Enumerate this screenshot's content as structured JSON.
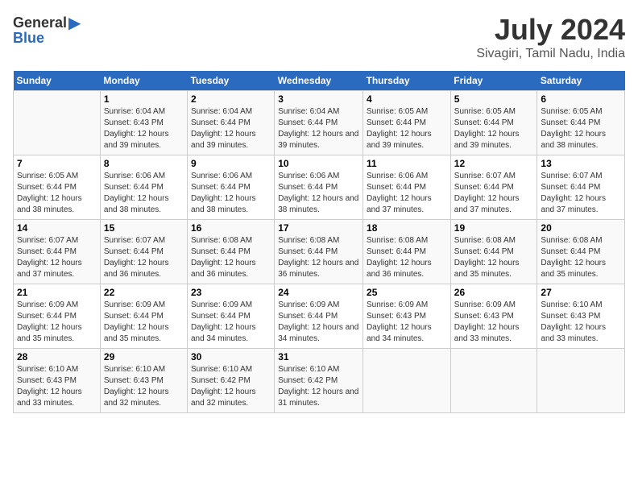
{
  "header": {
    "logo_general": "General",
    "logo_blue": "Blue",
    "title": "July 2024",
    "location": "Sivagiri, Tamil Nadu, India"
  },
  "calendar": {
    "days_of_week": [
      "Sunday",
      "Monday",
      "Tuesday",
      "Wednesday",
      "Thursday",
      "Friday",
      "Saturday"
    ],
    "weeks": [
      [
        {
          "day": "",
          "sunrise": "",
          "sunset": "",
          "daylight": ""
        },
        {
          "day": "1",
          "sunrise": "Sunrise: 6:04 AM",
          "sunset": "Sunset: 6:43 PM",
          "daylight": "Daylight: 12 hours and 39 minutes."
        },
        {
          "day": "2",
          "sunrise": "Sunrise: 6:04 AM",
          "sunset": "Sunset: 6:44 PM",
          "daylight": "Daylight: 12 hours and 39 minutes."
        },
        {
          "day": "3",
          "sunrise": "Sunrise: 6:04 AM",
          "sunset": "Sunset: 6:44 PM",
          "daylight": "Daylight: 12 hours and 39 minutes."
        },
        {
          "day": "4",
          "sunrise": "Sunrise: 6:05 AM",
          "sunset": "Sunset: 6:44 PM",
          "daylight": "Daylight: 12 hours and 39 minutes."
        },
        {
          "day": "5",
          "sunrise": "Sunrise: 6:05 AM",
          "sunset": "Sunset: 6:44 PM",
          "daylight": "Daylight: 12 hours and 39 minutes."
        },
        {
          "day": "6",
          "sunrise": "Sunrise: 6:05 AM",
          "sunset": "Sunset: 6:44 PM",
          "daylight": "Daylight: 12 hours and 38 minutes."
        }
      ],
      [
        {
          "day": "7",
          "sunrise": "Sunrise: 6:05 AM",
          "sunset": "Sunset: 6:44 PM",
          "daylight": "Daylight: 12 hours and 38 minutes."
        },
        {
          "day": "8",
          "sunrise": "Sunrise: 6:06 AM",
          "sunset": "Sunset: 6:44 PM",
          "daylight": "Daylight: 12 hours and 38 minutes."
        },
        {
          "day": "9",
          "sunrise": "Sunrise: 6:06 AM",
          "sunset": "Sunset: 6:44 PM",
          "daylight": "Daylight: 12 hours and 38 minutes."
        },
        {
          "day": "10",
          "sunrise": "Sunrise: 6:06 AM",
          "sunset": "Sunset: 6:44 PM",
          "daylight": "Daylight: 12 hours and 38 minutes."
        },
        {
          "day": "11",
          "sunrise": "Sunrise: 6:06 AM",
          "sunset": "Sunset: 6:44 PM",
          "daylight": "Daylight: 12 hours and 37 minutes."
        },
        {
          "day": "12",
          "sunrise": "Sunrise: 6:07 AM",
          "sunset": "Sunset: 6:44 PM",
          "daylight": "Daylight: 12 hours and 37 minutes."
        },
        {
          "day": "13",
          "sunrise": "Sunrise: 6:07 AM",
          "sunset": "Sunset: 6:44 PM",
          "daylight": "Daylight: 12 hours and 37 minutes."
        }
      ],
      [
        {
          "day": "14",
          "sunrise": "Sunrise: 6:07 AM",
          "sunset": "Sunset: 6:44 PM",
          "daylight": "Daylight: 12 hours and 37 minutes."
        },
        {
          "day": "15",
          "sunrise": "Sunrise: 6:07 AM",
          "sunset": "Sunset: 6:44 PM",
          "daylight": "Daylight: 12 hours and 36 minutes."
        },
        {
          "day": "16",
          "sunrise": "Sunrise: 6:08 AM",
          "sunset": "Sunset: 6:44 PM",
          "daylight": "Daylight: 12 hours and 36 minutes."
        },
        {
          "day": "17",
          "sunrise": "Sunrise: 6:08 AM",
          "sunset": "Sunset: 6:44 PM",
          "daylight": "Daylight: 12 hours and 36 minutes."
        },
        {
          "day": "18",
          "sunrise": "Sunrise: 6:08 AM",
          "sunset": "Sunset: 6:44 PM",
          "daylight": "Daylight: 12 hours and 36 minutes."
        },
        {
          "day": "19",
          "sunrise": "Sunrise: 6:08 AM",
          "sunset": "Sunset: 6:44 PM",
          "daylight": "Daylight: 12 hours and 35 minutes."
        },
        {
          "day": "20",
          "sunrise": "Sunrise: 6:08 AM",
          "sunset": "Sunset: 6:44 PM",
          "daylight": "Daylight: 12 hours and 35 minutes."
        }
      ],
      [
        {
          "day": "21",
          "sunrise": "Sunrise: 6:09 AM",
          "sunset": "Sunset: 6:44 PM",
          "daylight": "Daylight: 12 hours and 35 minutes."
        },
        {
          "day": "22",
          "sunrise": "Sunrise: 6:09 AM",
          "sunset": "Sunset: 6:44 PM",
          "daylight": "Daylight: 12 hours and 35 minutes."
        },
        {
          "day": "23",
          "sunrise": "Sunrise: 6:09 AM",
          "sunset": "Sunset: 6:44 PM",
          "daylight": "Daylight: 12 hours and 34 minutes."
        },
        {
          "day": "24",
          "sunrise": "Sunrise: 6:09 AM",
          "sunset": "Sunset: 6:44 PM",
          "daylight": "Daylight: 12 hours and 34 minutes."
        },
        {
          "day": "25",
          "sunrise": "Sunrise: 6:09 AM",
          "sunset": "Sunset: 6:43 PM",
          "daylight": "Daylight: 12 hours and 34 minutes."
        },
        {
          "day": "26",
          "sunrise": "Sunrise: 6:09 AM",
          "sunset": "Sunset: 6:43 PM",
          "daylight": "Daylight: 12 hours and 33 minutes."
        },
        {
          "day": "27",
          "sunrise": "Sunrise: 6:10 AM",
          "sunset": "Sunset: 6:43 PM",
          "daylight": "Daylight: 12 hours and 33 minutes."
        }
      ],
      [
        {
          "day": "28",
          "sunrise": "Sunrise: 6:10 AM",
          "sunset": "Sunset: 6:43 PM",
          "daylight": "Daylight: 12 hours and 33 minutes."
        },
        {
          "day": "29",
          "sunrise": "Sunrise: 6:10 AM",
          "sunset": "Sunset: 6:43 PM",
          "daylight": "Daylight: 12 hours and 32 minutes."
        },
        {
          "day": "30",
          "sunrise": "Sunrise: 6:10 AM",
          "sunset": "Sunset: 6:42 PM",
          "daylight": "Daylight: 12 hours and 32 minutes."
        },
        {
          "day": "31",
          "sunrise": "Sunrise: 6:10 AM",
          "sunset": "Sunset: 6:42 PM",
          "daylight": "Daylight: 12 hours and 31 minutes."
        },
        {
          "day": "",
          "sunrise": "",
          "sunset": "",
          "daylight": ""
        },
        {
          "day": "",
          "sunrise": "",
          "sunset": "",
          "daylight": ""
        },
        {
          "day": "",
          "sunrise": "",
          "sunset": "",
          "daylight": ""
        }
      ]
    ]
  }
}
